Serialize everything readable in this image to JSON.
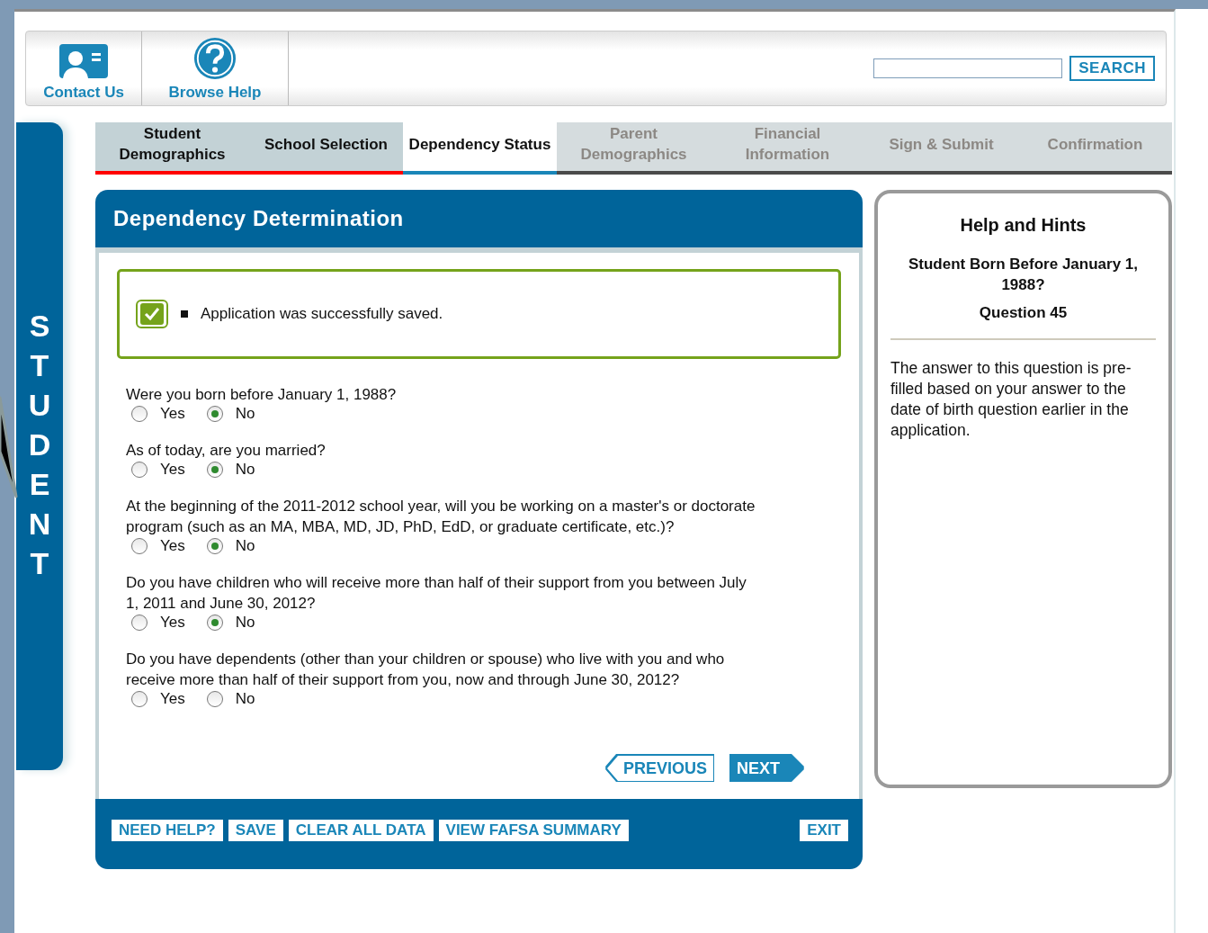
{
  "header": {
    "links": [
      {
        "label": "Contact Us",
        "kind": "contact"
      },
      {
        "label": "Browse Help",
        "kind": "help"
      }
    ],
    "search": {
      "button": "SEARCH"
    }
  },
  "sidebar": {
    "letters": [
      "S",
      "T",
      "U",
      "D",
      "E",
      "N",
      "T"
    ]
  },
  "tabs": [
    {
      "label": "Student Demographics",
      "completed": true,
      "selected": false
    },
    {
      "label": "School Selection",
      "completed": true,
      "selected": false
    },
    {
      "label": "Dependency Status",
      "completed": false,
      "selected": true
    },
    {
      "label": "Parent Demographics",
      "completed": false,
      "selected": false
    },
    {
      "label": "Financial Information",
      "completed": false,
      "selected": false
    },
    {
      "label": "Sign & Submit",
      "completed": false,
      "selected": false
    },
    {
      "label": "Confirmation",
      "completed": false,
      "selected": false
    }
  ],
  "panel": {
    "title": "Dependency Determination",
    "message": "Application was successfully saved.",
    "questions": [
      {
        "text": "Were you born before January 1, 1988?",
        "options": [
          {
            "label": "Yes",
            "selected": false
          },
          {
            "label": "No",
            "selected": true
          }
        ]
      },
      {
        "text": "As of today, are you married?",
        "options": [
          {
            "label": "Yes",
            "selected": false
          },
          {
            "label": "No",
            "selected": true
          }
        ]
      },
      {
        "text": "At the beginning of the 2011-2012 school year, will you be working on a master's or doctorate program (such as an MA, MBA, MD, JD, PhD, EdD, or graduate certificate, etc.)?",
        "options": [
          {
            "label": "Yes",
            "selected": false
          },
          {
            "label": "No",
            "selected": true
          }
        ]
      },
      {
        "text": "Do you have children who will receive more than half of their support from you between July 1, 2011 and June 30, 2012?",
        "options": [
          {
            "label": "Yes",
            "selected": false
          },
          {
            "label": "No",
            "selected": true
          }
        ]
      },
      {
        "text": "Do you have dependents (other than your children or spouse) who live with you and who receive more than half of their support from you, now and through June 30, 2012?",
        "options": [
          {
            "label": "Yes",
            "selected": false
          },
          {
            "label": "No",
            "selected": false
          }
        ]
      }
    ],
    "nav": {
      "previous": "PREVIOUS",
      "next": "NEXT"
    },
    "footer_buttons": [
      "NEED HELP?",
      "SAVE",
      "CLEAR ALL DATA",
      "VIEW FAFSA SUMMARY"
    ],
    "exit": "EXIT"
  },
  "help": {
    "title": "Help and Hints",
    "subtitle": "Student Born Before January 1, 1988?",
    "question": "Question 45",
    "body": "The answer to this question is pre-filled based on your answer to the date of birth question earlier in the application."
  }
}
